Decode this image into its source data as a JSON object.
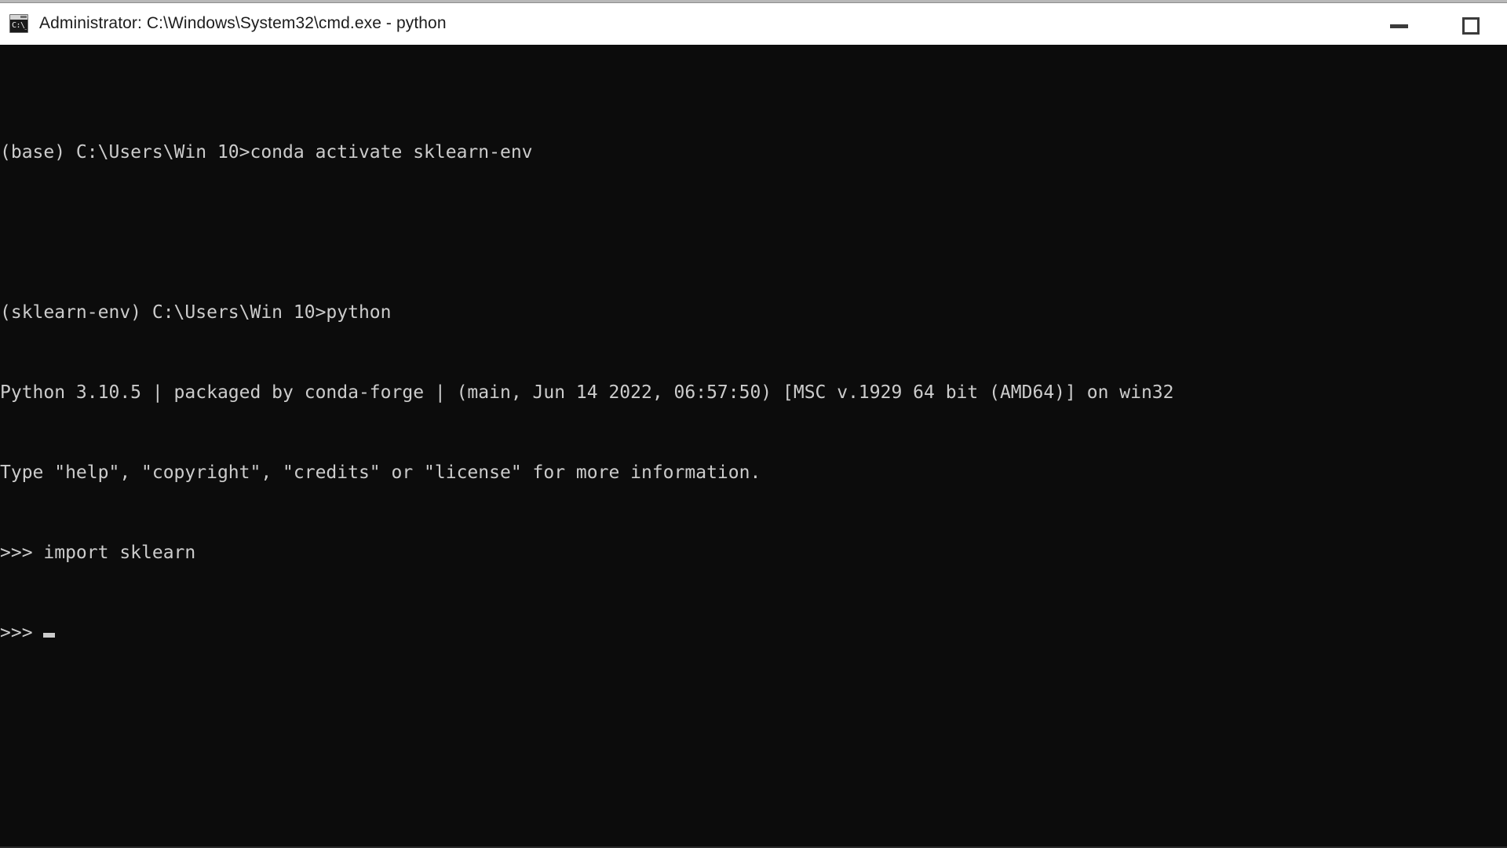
{
  "window": {
    "title": "Administrator: C:\\Windows\\System32\\cmd.exe - python",
    "icon_name": "cmd-exe-icon",
    "icon_glyph": "C:\\_",
    "background_color": "#0c0c0c",
    "titlebar_color": "#ffffff",
    "text_color": "#cccccc"
  },
  "controls": {
    "minimize_label": "Minimize",
    "maximize_label": "Maximize",
    "minimize_glyph": "—",
    "maximize_glyph": "□"
  },
  "terminal": {
    "prompt_symbol": ">>>",
    "cursor_visible": true,
    "lines": [
      "(base) C:\\Users\\Win 10>conda activate sklearn-env",
      "",
      "(sklearn-env) C:\\Users\\Win 10>python",
      "Python 3.10.5 | packaged by conda-forge | (main, Jun 14 2022, 06:57:50) [MSC v.1929 64 bit (AMD64)] on win32",
      "Type \"help\", \"copyright\", \"credits\" or \"license\" for more information.",
      ">>> import sklearn",
      ">>> "
    ]
  }
}
